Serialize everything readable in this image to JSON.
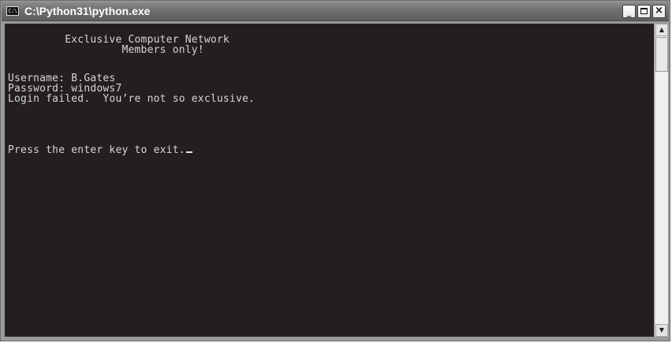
{
  "window": {
    "title": "C:\\Python31\\python.exe",
    "icon_label": "C:\\",
    "controls": {
      "minimize": "_",
      "maximize": "maximize-icon",
      "close": "×"
    }
  },
  "console": {
    "lines": [
      "         Exclusive Computer Network",
      "                  Members only!",
      "Username: B.Gates",
      "Password: windows7",
      "Login failed.  You’re not so exclusive.",
      "Press the enter key to exit."
    ]
  },
  "scrollbar": {
    "up_arrow": "▲",
    "down_arrow": "▼"
  }
}
